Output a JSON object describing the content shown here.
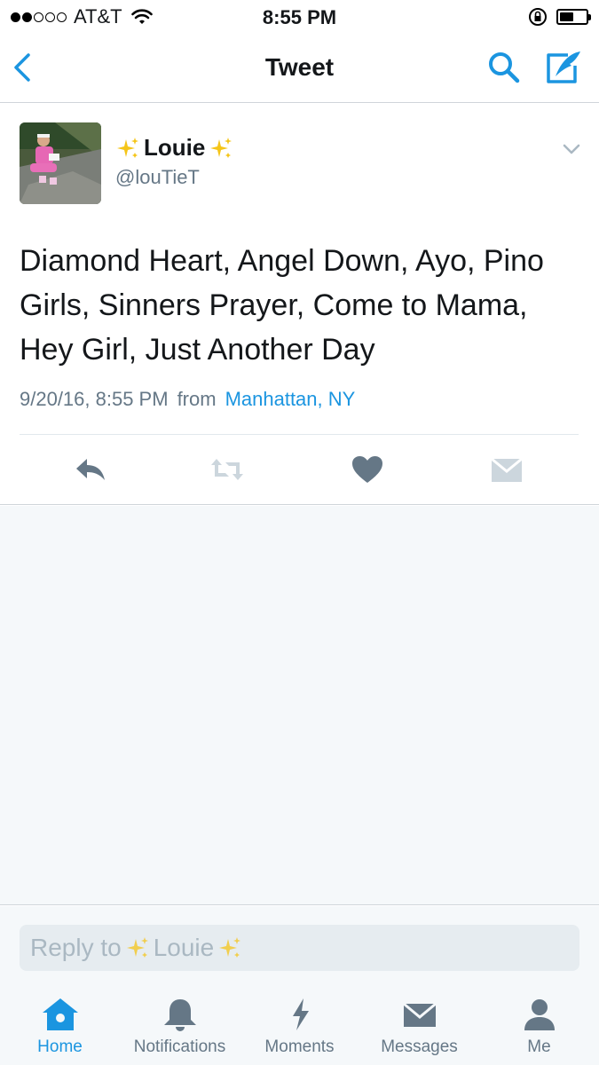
{
  "status_bar": {
    "carrier": "AT&T",
    "time": "8:55 PM",
    "signal_filled": 2,
    "signal_total": 5
  },
  "nav": {
    "title": "Tweet",
    "back_icon": "chevron-left-icon",
    "search_icon": "search-icon",
    "compose_icon": "compose-tweet-icon"
  },
  "tweet": {
    "display_name": "Louie",
    "handle": "@louTieT",
    "text": "Diamond Heart, Angel Down, Ayo, Pino Girls, Sinners Prayer, Come to Mama, Hey Girl, Just Another Day",
    "timestamp": "9/20/16, 8:55 PM",
    "from_label": "from",
    "location": "Manhattan, NY",
    "actions": [
      "reply-icon",
      "retweet-icon",
      "like-icon",
      "direct-message-icon"
    ]
  },
  "reply": {
    "placeholder_prefix": "Reply to",
    "placeholder_name": "Louie"
  },
  "tabs": [
    {
      "label": "Home",
      "icon": "home-icon",
      "active": true
    },
    {
      "label": "Notifications",
      "icon": "bell-icon",
      "active": false
    },
    {
      "label": "Moments",
      "icon": "lightning-icon",
      "active": false
    },
    {
      "label": "Messages",
      "icon": "envelope-icon",
      "active": false
    },
    {
      "label": "Me",
      "icon": "person-icon",
      "active": false
    }
  ],
  "colors": {
    "accent": "#1b95e0",
    "secondary_text": "#657786",
    "icon_gray": "#657786",
    "background_gray": "#f5f8fa",
    "sparkle": "#f5c518"
  }
}
